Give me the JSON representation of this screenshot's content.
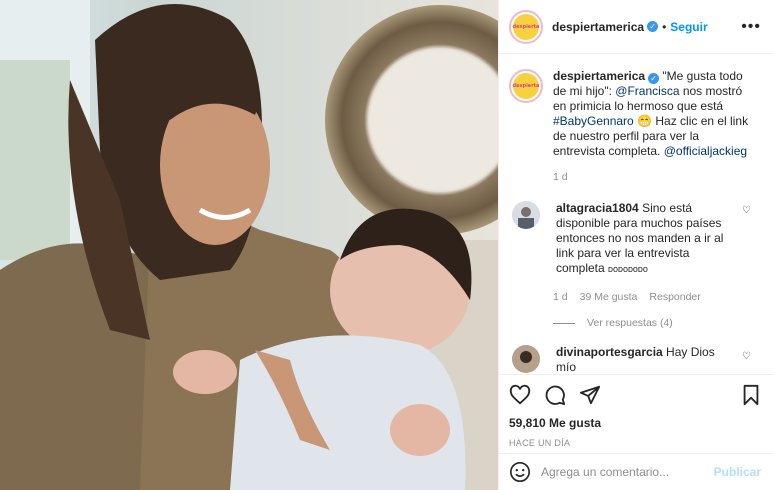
{
  "header": {
    "username": "despiertamerica",
    "verified_icon": "verified-badge-icon",
    "separator": "•",
    "follow_label": "Seguir",
    "more_label": "•••"
  },
  "avatar": {
    "label": "despierta"
  },
  "caption": {
    "username": "despiertamerica",
    "text_1": " \"Me gusta todo de mi hijo\": ",
    "mention_1": "@Francisca",
    "text_2": " nos mostró en primicia lo hermoso que está ",
    "hashtag": "#BabyGennaro",
    "emoji": "😁",
    "text_3": " Haz clic en el link de nuestro perfil para ver la entrevista completa. ",
    "mention_2": "@officialjackieg",
    "time": "1 d"
  },
  "comments": [
    {
      "username": "altagracia1804",
      "text": " Sino está disponible para muchos países entonces no nos manden a ir al link para ver la entrevista completa ",
      "tail": "ᴅᴏᴅᴏᴅᴏᴅᴏ",
      "time": "1 d",
      "likes": "39 Me gusta",
      "reply_label": "Responder",
      "view_replies": "Ver respuestas (4)"
    },
    {
      "username": "divinaportesgarcia",
      "text": " Hay Dios mío"
    }
  ],
  "actions": {
    "likes": "59,810 Me gusta",
    "ago": "HACE UN DÍA"
  },
  "add_comment": {
    "placeholder": "Agrega un comentario...",
    "publish_label": "Publicar"
  },
  "colors": {
    "accent": "#0095f6",
    "link": "#00376b",
    "muted": "#8e8e8e",
    "publish_disabled": "#b2dffc"
  }
}
